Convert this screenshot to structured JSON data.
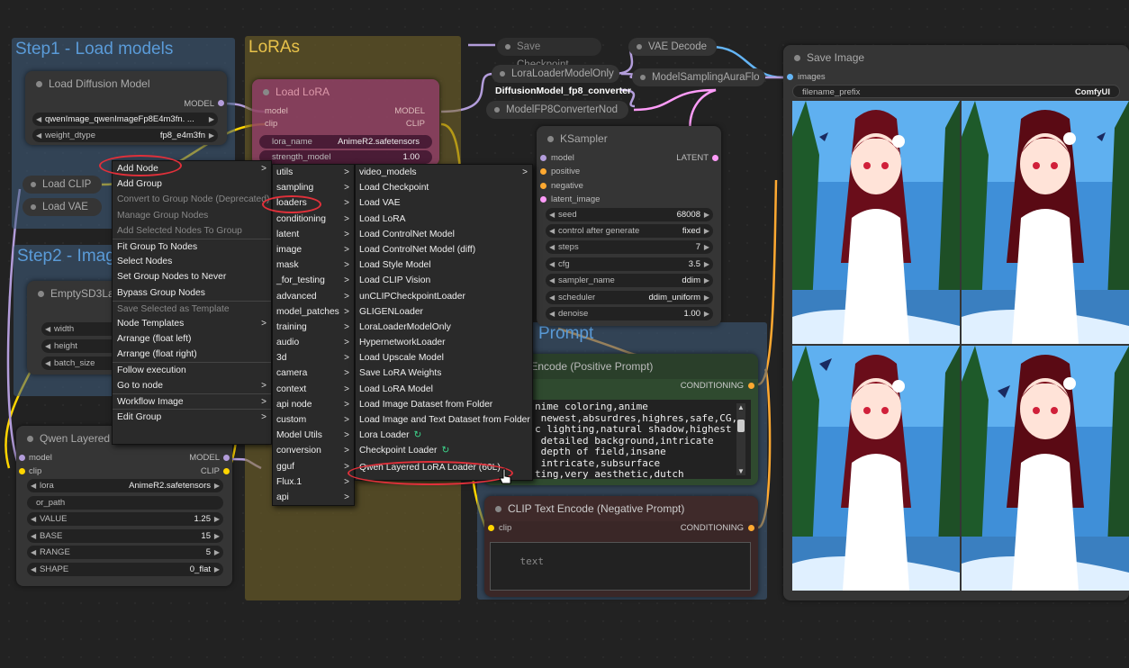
{
  "groups": {
    "step1": "Step1 - Load models",
    "loras": "LoRAs",
    "step2": "Step2 - Imag",
    "prompt": "Prompt"
  },
  "nodes": {
    "load_diffusion": {
      "title": "Load Diffusion Model",
      "output": "MODEL",
      "unet_name": "qwenImage_qwenImageFp8E4m3fn. ...",
      "weight_dtype_label": "weight_dtype",
      "weight_dtype_value": "fp8_e4m3fn"
    },
    "load_clip": {
      "title": "Load CLIP"
    },
    "load_vae": {
      "title": "Load VAE"
    },
    "load_lora": {
      "title": "Load LoRA",
      "inputs": [
        "model",
        "clip"
      ],
      "outputs": [
        "MODEL",
        "CLIP"
      ],
      "lora_label": "lora_name",
      "lora_value": "AnimeR2.safetensors",
      "strength_model_label": "strength_model",
      "strength_model_value": "1.00"
    },
    "empty_latent": {
      "title": "EmptySD3Late",
      "width_label": "width",
      "height_label": "height",
      "batch_label": "batch_size"
    },
    "qwen_layered": {
      "title": "Qwen Layered Lo",
      "inputs": [
        "model",
        "clip"
      ],
      "outputs": [
        "MODEL",
        "CLIP"
      ],
      "widgets": [
        {
          "label": "lora",
          "value": "AnimeR2.safetensors"
        },
        {
          "label": "or_path",
          "value": ""
        },
        {
          "label": "VALUE",
          "value": "1.25"
        },
        {
          "label": "BASE",
          "value": "15"
        },
        {
          "label": "RANGE",
          "value": "5"
        },
        {
          "label": "SHAPE",
          "value": "0_flat"
        }
      ]
    },
    "save_checkpoint": {
      "title": "Save Checkpoint"
    },
    "vae_decode": {
      "title": "VAE Decode"
    },
    "lora_loader_model_only": {
      "title": "LoraLoaderModelOnly"
    },
    "model_sampling_aura": {
      "title": "ModelSamplingAuraFlo"
    },
    "diffusion_fp8_converter": {
      "title": "DiffusionModel_fp8_converter"
    },
    "model_fp8_converter": {
      "title": "ModelFP8ConverterNod"
    },
    "ksampler": {
      "title": "KSampler",
      "inputs": [
        "model",
        "positive",
        "negative",
        "latent_image"
      ],
      "output": "LATENT",
      "widgets": [
        {
          "label": "seed",
          "value": "68008"
        },
        {
          "label": "control after generate",
          "value": "fixed"
        },
        {
          "label": "steps",
          "value": "7"
        },
        {
          "label": "cfg",
          "value": "3.5"
        },
        {
          "label": "sampler_name",
          "value": "ddim"
        },
        {
          "label": "scheduler",
          "value": "ddim_uniform"
        },
        {
          "label": "denoise",
          "value": "1.00"
        }
      ]
    },
    "clip_positive": {
      "title": "Text Encode (Positive Prompt)",
      "output": "CONDITIONING",
      "text": "nime coloring,anime\n newest,absurdres,highres,safe,CG,c\nc lighting,natural shadow,highest\n detailed background,intricate\n depth of field,insane\n intricate,subsurface\nting,very aesthetic,dutch"
    },
    "clip_negative": {
      "title": "CLIP Text Encode (Negative Prompt)",
      "input": "clip",
      "output": "CONDITIONING",
      "placeholder": "text"
    },
    "save_image": {
      "title": "Save Image",
      "input": "images",
      "prefix_label": "filename_prefix",
      "prefix_value": "ComfyUI"
    }
  },
  "context_menu": {
    "items": [
      {
        "label": "Add Node",
        "sub": true
      },
      {
        "label": "Add Group"
      },
      {
        "label": "Convert to Group Node (Deprecated)",
        "disabled": true
      },
      {
        "label": "Manage Group Nodes",
        "disabled": true
      },
      {
        "label": "Add Selected Nodes To Group",
        "disabled": true
      },
      {
        "label": "Fit Group To Nodes",
        "sep": true
      },
      {
        "label": "Select Nodes"
      },
      {
        "label": "Set Group Nodes to Never"
      },
      {
        "label": "Bypass Group Nodes"
      },
      {
        "label": "Save Selected as Template",
        "disabled": true,
        "sep": true
      },
      {
        "label": "Node Templates",
        "sub": true
      },
      {
        "label": "Arrange (float left)"
      },
      {
        "label": "Arrange (float right)"
      },
      {
        "label": "Follow execution",
        "sep": true
      },
      {
        "label": "Go to node",
        "sub": true
      },
      {
        "label": "Workflow Image",
        "sub": true,
        "sep": true
      },
      {
        "label": "Edit Group",
        "sub": true,
        "sep": true
      }
    ]
  },
  "category_menu": {
    "items": [
      "utils",
      "sampling",
      "loaders",
      "conditioning",
      "latent",
      "image",
      "mask",
      "_for_testing",
      "advanced",
      "model_patches",
      "training",
      "audio",
      "3d",
      "camera",
      "context",
      "api node",
      "custom",
      "Model Utils",
      "conversion",
      "gguf",
      "Flux.1",
      "api"
    ]
  },
  "loaders_menu": {
    "items": [
      "video_models",
      "Load Checkpoint",
      "Load VAE",
      "Load LoRA",
      "Load ControlNet Model",
      "Load ControlNet Model (diff)",
      "Load Style Model",
      "Load CLIP Vision",
      "unCLIPCheckpointLoader",
      "GLIGENLoader",
      "LoraLoaderModelOnly",
      "HypernetworkLoader",
      "Load Upscale Model",
      "Save LoRA Weights",
      "Load LoRA Model",
      "Load Image Dataset from Folder",
      "Load Image and Text Dataset from Folder",
      "Lora Loader",
      "Checkpoint Loader",
      "Qwen Layered LoRA Loader (60L)"
    ]
  },
  "colors": {
    "group_step1": "#3f5f80",
    "group_loras": "#7a6a2a",
    "annotation_red": "#e0303a",
    "wire_clip": "#ffd500",
    "wire_model": "#b39ddb",
    "wire_latent": "#ff9cf9",
    "wire_conditioning": "#ffa931",
    "wire_image": "#64b5f6"
  }
}
